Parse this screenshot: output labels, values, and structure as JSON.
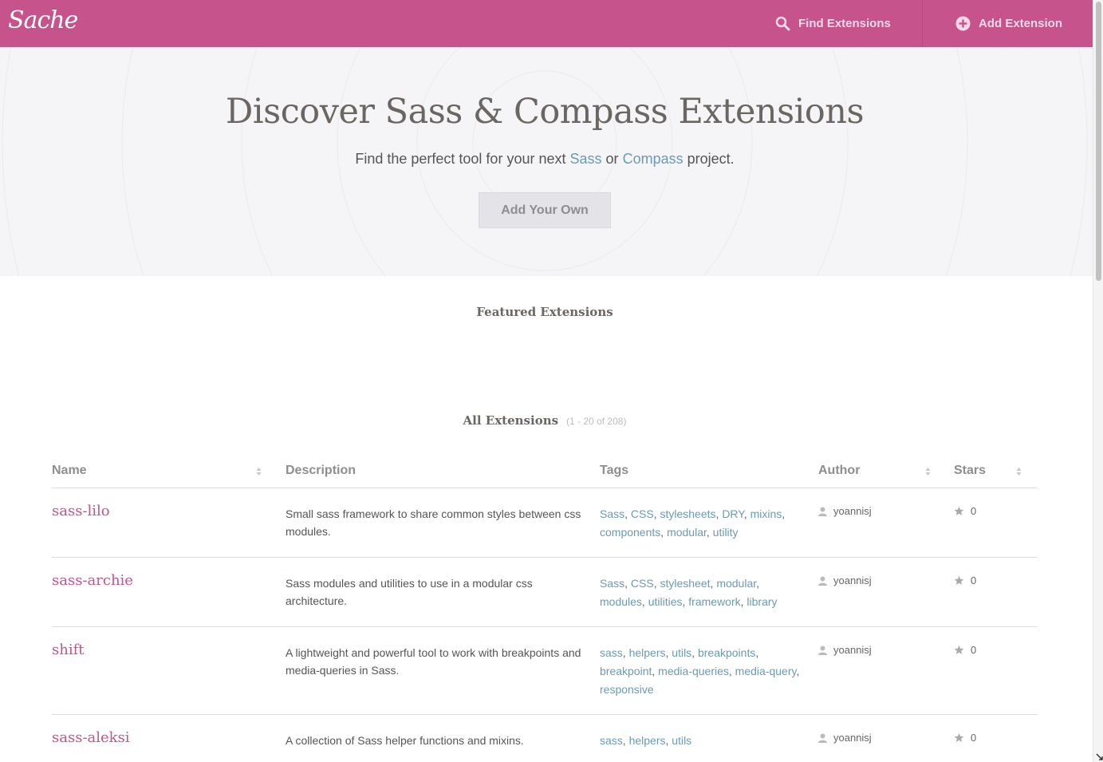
{
  "header": {
    "logo_text": "Sache",
    "find_label": "Find Extensions",
    "add_label": "Add Extension",
    "brand_color": "#c6538c"
  },
  "hero": {
    "title": "Discover Sass & Compass Extensions",
    "sub_before": "Find the perfect tool for your next",
    "sub_link1": "Sass",
    "sub_middle": "or",
    "sub_link2": "Compass",
    "sub_after": "project.",
    "button_label": "Add Your Own"
  },
  "featured": {
    "title": "Featured Extensions"
  },
  "all": {
    "title": "All Extensions",
    "count": "(1 - 20 of 208)"
  },
  "table": {
    "columns": {
      "name": "Name",
      "description": "Description",
      "tags": "Tags",
      "author": "Author",
      "stars": "Stars"
    },
    "rows": [
      {
        "name": "sass-lilo",
        "description": "Small sass framework to share common styles between css modules.",
        "tags": [
          "Sass",
          "CSS",
          "stylesheets",
          "DRY",
          "mixins",
          "components",
          "modular",
          "utility"
        ],
        "author": "yoannisj",
        "stars": "0"
      },
      {
        "name": "sass-archie",
        "description": "Sass modules and utilities to use in a modular css architecture.",
        "tags": [
          "Sass",
          "CSS",
          "stylesheet",
          "modular",
          "modules",
          "utilities",
          "framework",
          "library"
        ],
        "author": "yoannisj",
        "stars": "0"
      },
      {
        "name": "shift",
        "description": "A lightweight and powerful tool to work with breakpoints and media-queries in Sass.",
        "tags": [
          "sass",
          "helpers",
          "utils",
          "breakpoints",
          "breakpoint",
          "media-queries",
          "media-query",
          "responsive"
        ],
        "author": "yoannisj",
        "stars": "0"
      },
      {
        "name": "sass-aleksi",
        "description": "A collection of Sass helper functions and mixins.",
        "tags": [
          "sass",
          "helpers",
          "utils"
        ],
        "author": "yoannisj",
        "stars": "0"
      }
    ]
  }
}
